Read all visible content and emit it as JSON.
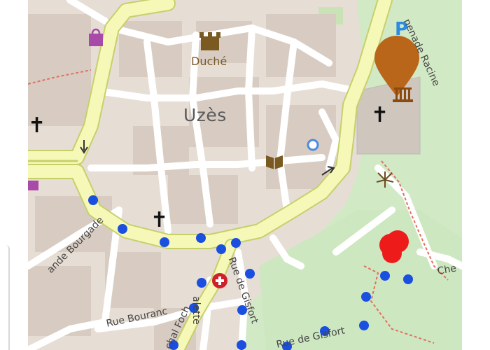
{
  "map": {
    "town_name": "Uzès",
    "poi": {
      "duche_label": "Duché"
    },
    "streets": {
      "rue_bouracon": "Rue Bouranc",
      "rue_de_gisfort": "Rue de Gisfort",
      "rue_de_gisfort_vertical": "Rue de Gisfort",
      "grande_bourgade": "ande Bourgade",
      "promenade_racine": "nenade Racine",
      "marechal_foch": "chal Foch",
      "ruelle": "alette",
      "chemin": "Che"
    },
    "parking_symbol": "P",
    "colors": {
      "route_dot": "#1a4fe0",
      "primary_road": "#f6f8b8",
      "primary_road_edge": "#c7cf6b",
      "park_green": "#cde8c0",
      "poi_pin": "#b9651a",
      "hospital_red": "#d0202a",
      "target_marker": "#ee1b1b"
    },
    "icons": {
      "castle": "castle-icon",
      "museum": "museum-pin-icon",
      "book": "library-icon",
      "shopping": "shopping-bag-icon",
      "hospital": "hospital-icon",
      "church": "church-cross-icon"
    }
  }
}
